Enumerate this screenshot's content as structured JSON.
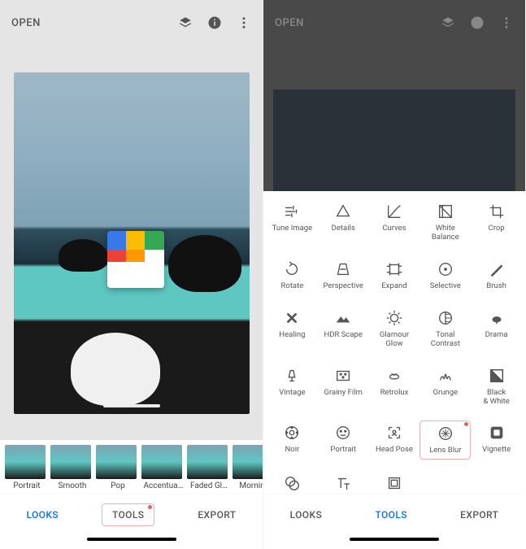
{
  "left": {
    "open_label": "OPEN",
    "looks": [
      {
        "label": "Portrait"
      },
      {
        "label": "Smooth"
      },
      {
        "label": "Pop"
      },
      {
        "label": "Accentua…"
      },
      {
        "label": "Faded Gl…"
      },
      {
        "label": "Morning"
      }
    ],
    "tabs": {
      "looks": "LOOKS",
      "tools": "TOOLS",
      "export": "EXPORT"
    }
  },
  "right": {
    "open_label": "OPEN",
    "tools": [
      {
        "label": "Tune Image"
      },
      {
        "label": "Details"
      },
      {
        "label": "Curves"
      },
      {
        "label": "White\nBalance"
      },
      {
        "label": "Crop"
      },
      {
        "label": "Rotate"
      },
      {
        "label": "Perspective"
      },
      {
        "label": "Expand"
      },
      {
        "label": "Selective"
      },
      {
        "label": "Brush"
      },
      {
        "label": "Healing"
      },
      {
        "label": "HDR Scape"
      },
      {
        "label": "Glamour\nGlow"
      },
      {
        "label": "Tonal\nContrast"
      },
      {
        "label": "Drama"
      },
      {
        "label": "Vintage"
      },
      {
        "label": "Grainy Film"
      },
      {
        "label": "Retrolux"
      },
      {
        "label": "Grunge"
      },
      {
        "label": "Black\n& White"
      },
      {
        "label": "Noir"
      },
      {
        "label": "Portrait"
      },
      {
        "label": "Head Pose"
      },
      {
        "label": "Lens Blur"
      },
      {
        "label": "Vignette"
      },
      {
        "label": "Double\nExposure"
      },
      {
        "label": "Text"
      },
      {
        "label": "Frames"
      }
    ],
    "tabs": {
      "looks": "LOOKS",
      "tools": "TOOLS",
      "export": "EXPORT"
    }
  }
}
